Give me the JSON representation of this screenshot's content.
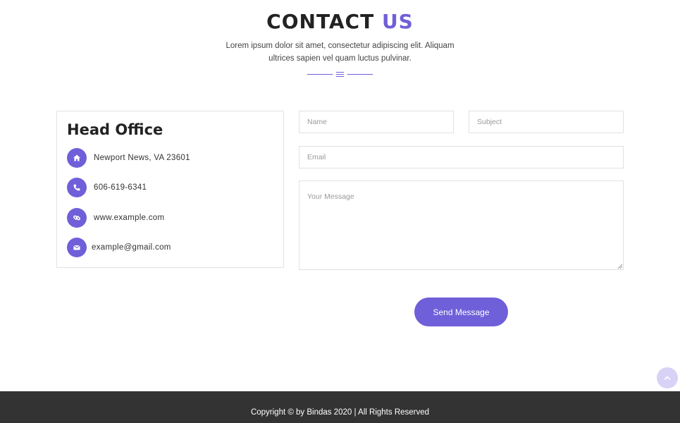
{
  "header": {
    "title_main": "CONTACT",
    "title_accent": "US",
    "description": "Lorem ipsum dolor sit amet, consectetur adipiscing elit. Aliquam ultrices sapien vel quam luctus pulvinar."
  },
  "office": {
    "title": "Head Office",
    "items": [
      {
        "icon": "home-icon",
        "text": "Newport News, VA 23601"
      },
      {
        "icon": "phone-icon",
        "text": "606-619-6341"
      },
      {
        "icon": "link-icon",
        "text": "www.example.com"
      },
      {
        "icon": "envelope-icon",
        "text": "example@gmail.com"
      }
    ]
  },
  "form": {
    "name_placeholder": "Name",
    "subject_placeholder": "Subject",
    "email_placeholder": "Email",
    "message_placeholder": "Your Message",
    "submit_label": "Send Message"
  },
  "back_to_top": {
    "icon": "chevron-up-icon"
  },
  "footer": {
    "copyright": "Copyright © by Bindas 2020 | All Rights Reserved"
  },
  "colors": {
    "accent": "#6f5fd9",
    "footer_bg": "#333333",
    "back_to_top_bg": "#d7d2f6"
  }
}
